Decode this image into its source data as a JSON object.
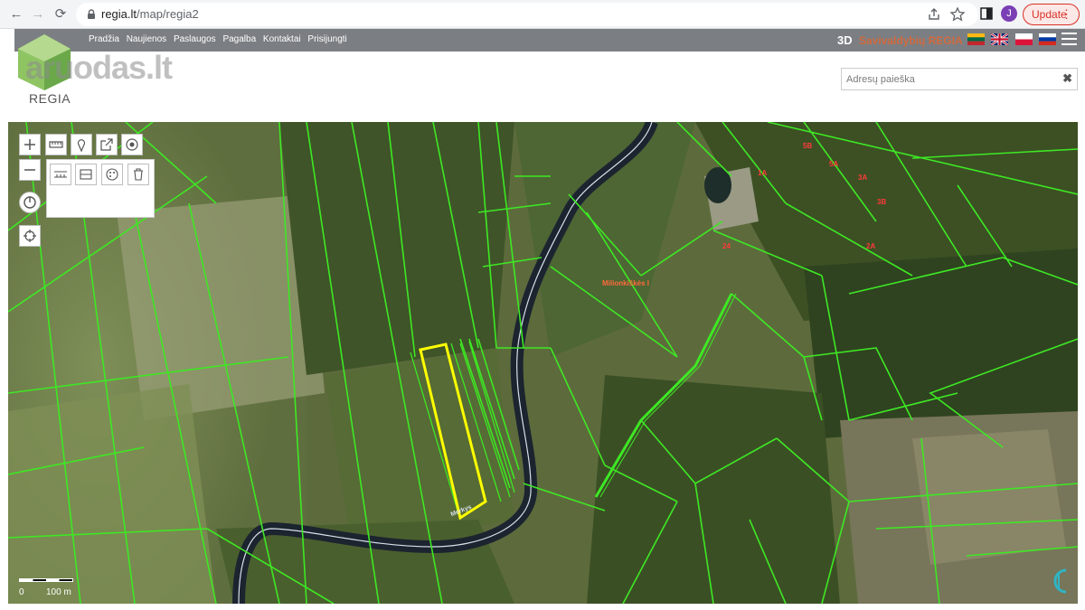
{
  "browser": {
    "url_host": "regia.lt",
    "url_path": "/map/regia2",
    "profile_initial": "J",
    "update_label": "Update",
    "update_menu": "⋮"
  },
  "site": {
    "nav": [
      "Pradžia",
      "Naujienos",
      "Paslaugos",
      "Pagalba",
      "Kontaktai",
      "Prisijungti"
    ],
    "brand_3d": "3D",
    "brand_name": "Savivaldybių REGIA",
    "logo_text": "REGIA",
    "watermark": "aruodas.lt",
    "languages": [
      "lt",
      "en",
      "pl",
      "ru"
    ]
  },
  "search": {
    "placeholder": "Adresų paieška",
    "value": "",
    "clear": "✖"
  },
  "map": {
    "tools": [
      "plus",
      "minus",
      "power",
      "locate"
    ],
    "toolbar": [
      "measure",
      "pin",
      "export",
      "target"
    ],
    "panel_tools": [
      "measure-length",
      "measure-area",
      "style",
      "trash"
    ],
    "labels": {
      "river": "Merkys",
      "place": "Milionkiškės I",
      "plots": [
        "2A",
        "3B",
        "3A",
        "5A",
        "5B",
        "1A",
        "24"
      ]
    },
    "scale": {
      "start": "0",
      "end": "100 m"
    }
  },
  "colors": {
    "parcel": "#3ee824",
    "selected": "#ffff00",
    "site_bar": "#7b7f83",
    "brand": "#d26a3e"
  }
}
